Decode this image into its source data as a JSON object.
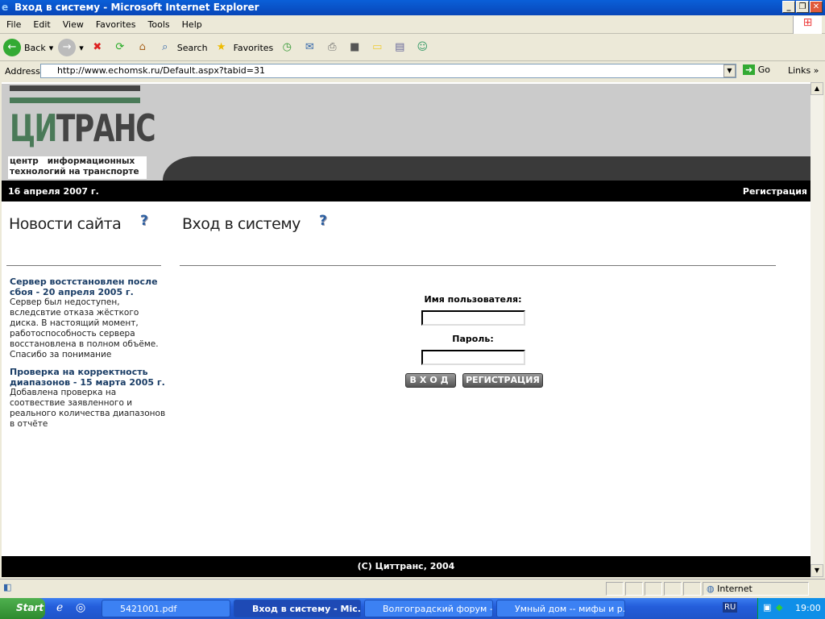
{
  "window": {
    "title": "Вход в систему - Microsoft Internet Explorer"
  },
  "menu": [
    "File",
    "Edit",
    "View",
    "Favorites",
    "Tools",
    "Help"
  ],
  "toolbar": {
    "back": "Back",
    "search": "Search",
    "favorites": "Favorites"
  },
  "address": {
    "label": "Address",
    "url": "http://www.echomsk.ru/Default.aspx?tabid=31",
    "go": "Go",
    "links": "Links"
  },
  "page": {
    "logo": {
      "main": "ЦИТРАНС",
      "line1": "центр   информационных",
      "line2": "технологий на транспорте"
    },
    "date": "16 апреля 2007 г.",
    "register_link": "Регистрация",
    "news_title": "Новости сайта",
    "login_title": "Вход в систему",
    "help_glyph": "?",
    "news": [
      {
        "title": "Сервер востстановлен после сбоя - 20 апреля 2005 г.",
        "body": "Сервер был недоступен, вследсвтие отказа жёсткого диска. В настоящий момент, работоспособность сервера восстановлена в полном объёме. Спасибо за понимание"
      },
      {
        "title": "Проверка на корректность диапазонов - 15 марта 2005 г.",
        "body": "Добавлена проверка на соотвествие заявленного и реального количества диапазонов в отчёте"
      }
    ],
    "form": {
      "username_label": "Имя пользователя:",
      "username_value": "",
      "password_label": "Пароль:",
      "password_value": "",
      "login_button": "ВХОД",
      "register_button": "РЕГИСТРАЦИЯ"
    },
    "footer": "(C) Циттранс, 2004"
  },
  "status": {
    "zone": "Internet"
  },
  "taskbar": {
    "start": "Start",
    "tasks": [
      "5421001.pdf",
      "Вход в систему - Mic...",
      "Волгоградский форум -...",
      "Умный дом -- мифы и р..."
    ],
    "lang": "RU",
    "clock": "19:00"
  }
}
